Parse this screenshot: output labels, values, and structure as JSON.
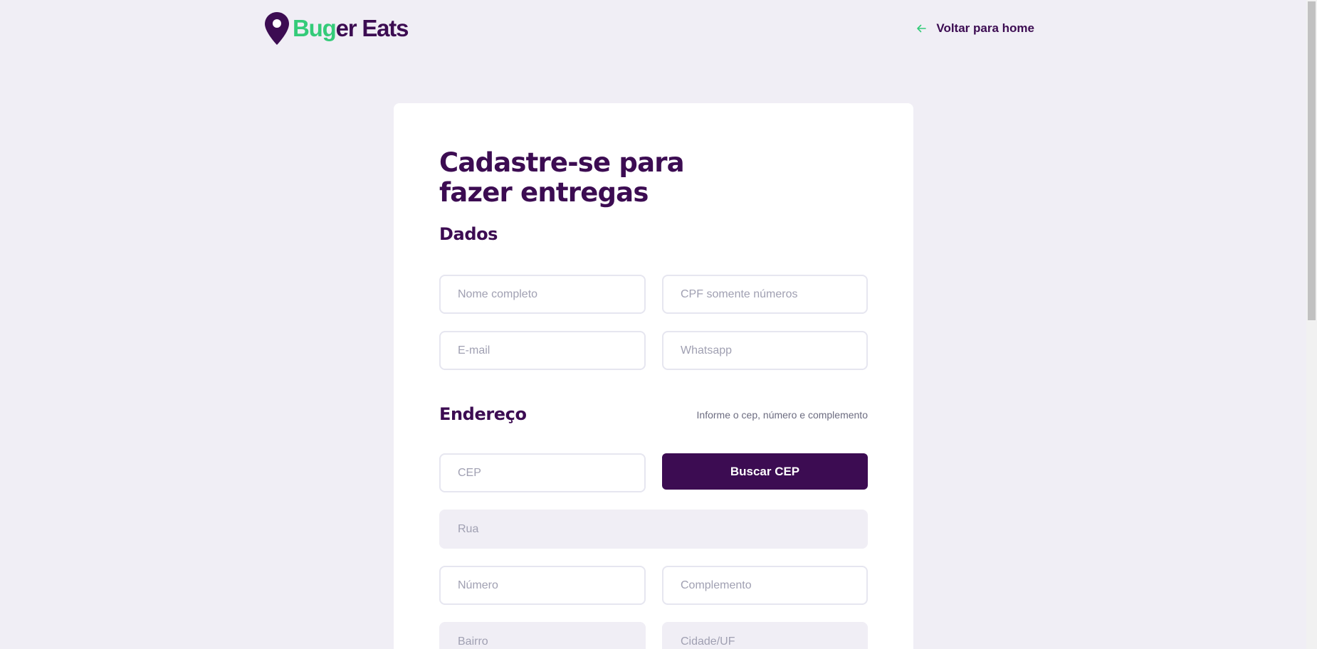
{
  "header": {
    "logo_word1": "Bug",
    "logo_word2": "er Eats",
    "back_link": "Voltar para home"
  },
  "form": {
    "title_line1": "Cadastre-se para",
    "title_line2": "fazer entregas",
    "section_dados": "Dados",
    "section_endereco": "Endereço",
    "endereco_hint": "Informe o cep, número e complemento",
    "fields": {
      "nome": "Nome completo",
      "cpf": "CPF somente números",
      "email": "E-mail",
      "whatsapp": "Whatsapp",
      "cep": "CEP",
      "rua": "Rua",
      "numero": "Número",
      "complemento": "Complemento",
      "bairro": "Bairro",
      "cidade": "Cidade/UF"
    },
    "buscar_cep": "Buscar CEP"
  },
  "colors": {
    "primary": "#3c0c52",
    "accent": "#34cb79",
    "background": "#f0eef5"
  }
}
